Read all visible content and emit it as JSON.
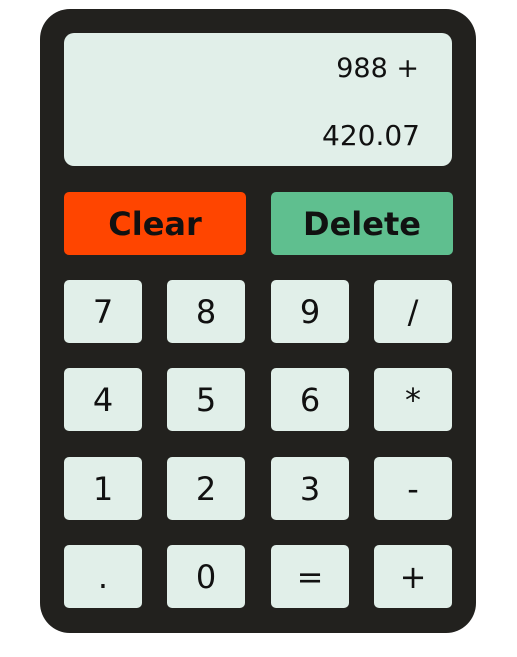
{
  "display": {
    "previous_operand": "988 +",
    "current_operand": "420.07"
  },
  "controls": {
    "clear_label": "Clear",
    "delete_label": "Delete"
  },
  "keys": {
    "seven": "7",
    "eight": "8",
    "nine": "9",
    "divide": "/",
    "four": "4",
    "five": "5",
    "six": "6",
    "multiply": "*",
    "one": "1",
    "two": "2",
    "three": "3",
    "subtract": "-",
    "decimal": ".",
    "zero": "0",
    "equals": "=",
    "add": "+"
  },
  "colors": {
    "body": "#22211e",
    "display_background": "#e1efe9",
    "key_background": "#e1efe9",
    "clear_background": "#ff4500",
    "delete_background": "#5fbf8f"
  }
}
